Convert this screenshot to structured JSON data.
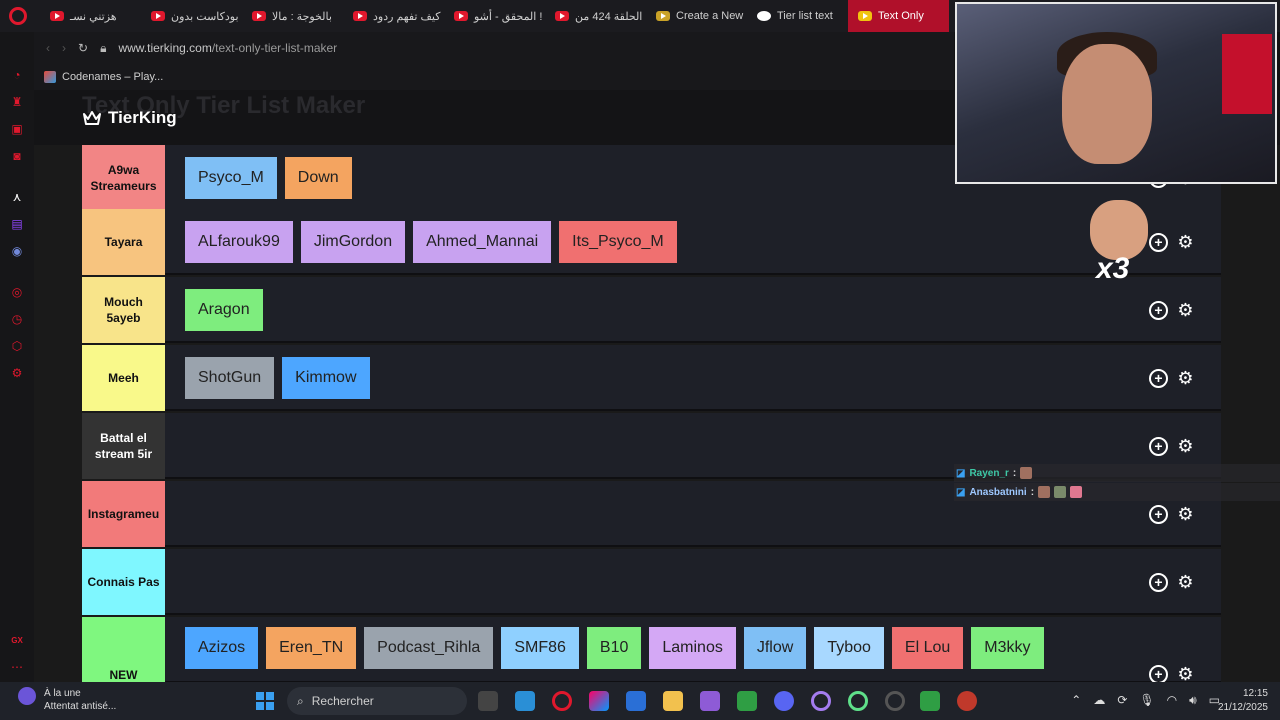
{
  "tabs": [
    {
      "label": "هزتني نسـ",
      "active": false
    },
    {
      "label": "بودكاست بدون",
      "active": false
    },
    {
      "label": "بالخوجة : مالا",
      "active": false
    },
    {
      "label": "كيف تفهم ردود",
      "active": false
    },
    {
      "label": "المحقق - أشو !",
      "active": false
    },
    {
      "label": "الحلقة 424 من",
      "active": false
    },
    {
      "label": "Create a New",
      "active": false
    },
    {
      "label": "Tier list text",
      "active": false
    },
    {
      "label": "Text Only",
      "active": true
    }
  ],
  "address": {
    "host": "www.tierking.com",
    "path": "/text-only-tier-list-maker"
  },
  "bookmarks": [
    {
      "label": "Codenames – Play..."
    }
  ],
  "site": {
    "brand": "TierKing",
    "faded_title": "Text Only Tier List Maker"
  },
  "tiers": [
    {
      "label": "A9wa Streameurs",
      "color": "#f28585",
      "items": [
        {
          "text": "Psyco_M",
          "color": "#7fbff5"
        },
        {
          "text": "Down",
          "color": "#f4a460"
        }
      ]
    },
    {
      "label": "Tayara",
      "color": "#f7c47f",
      "items": [
        {
          "text": "ALfarouk99",
          "color": "#c8a2f0"
        },
        {
          "text": "JimGordon",
          "color": "#c8a2f0"
        },
        {
          "text": "Ahmed_Mannai",
          "color": "#c8a2f0"
        },
        {
          "text": "Its_Psyco_M",
          "color": "#f07070"
        }
      ]
    },
    {
      "label": "Mouch 5ayeb",
      "color": "#f8e48a",
      "items": [
        {
          "text": "Aragon",
          "color": "#7eed7e"
        }
      ]
    },
    {
      "label": "Meeh",
      "color": "#f9f98a",
      "items": [
        {
          "text": "ShotGun",
          "color": "#9aa3ad"
        },
        {
          "text": "Kimmow",
          "color": "#4da6ff"
        }
      ]
    },
    {
      "label": "Battal el stream 5ir",
      "color": "#333333",
      "label_color": "#ffffff",
      "items": []
    },
    {
      "label": "Instagrameu",
      "color": "#f27a7a",
      "items": []
    },
    {
      "label": "Connais Pas",
      "color": "#7ff7ff",
      "items": []
    },
    {
      "label": "NEW",
      "color": "#7ff77f",
      "items": [
        {
          "text": "Azizos",
          "color": "#4da6ff"
        },
        {
          "text": "Eren_TN",
          "color": "#f4a460"
        },
        {
          "text": "Podcast_Rihla",
          "color": "#9aa3ad"
        },
        {
          "text": "SMF86",
          "color": "#8fd0ff"
        },
        {
          "text": "B10",
          "color": "#7eed7e"
        },
        {
          "text": "Laminos",
          "color": "#d4a8f5"
        },
        {
          "text": "Jflow",
          "color": "#7fbff5"
        },
        {
          "text": "Tyboo",
          "color": "#a8d8ff"
        },
        {
          "text": "El Lou",
          "color": "#f07070"
        },
        {
          "text": "M3kky",
          "color": "#7eed7e"
        }
      ]
    }
  ],
  "chat": [
    {
      "nick": "Rayen_r",
      "sep": ":"
    },
    {
      "nick": "Anasbatnini",
      "sep": ":"
    }
  ],
  "overlay": {
    "multiplier": "x3"
  },
  "taskbar": {
    "news_title": "À la une",
    "news_sub": "Attentat antisé...",
    "search_placeholder": "Rechercher",
    "time": "12:15",
    "date": "21/12/2025"
  }
}
